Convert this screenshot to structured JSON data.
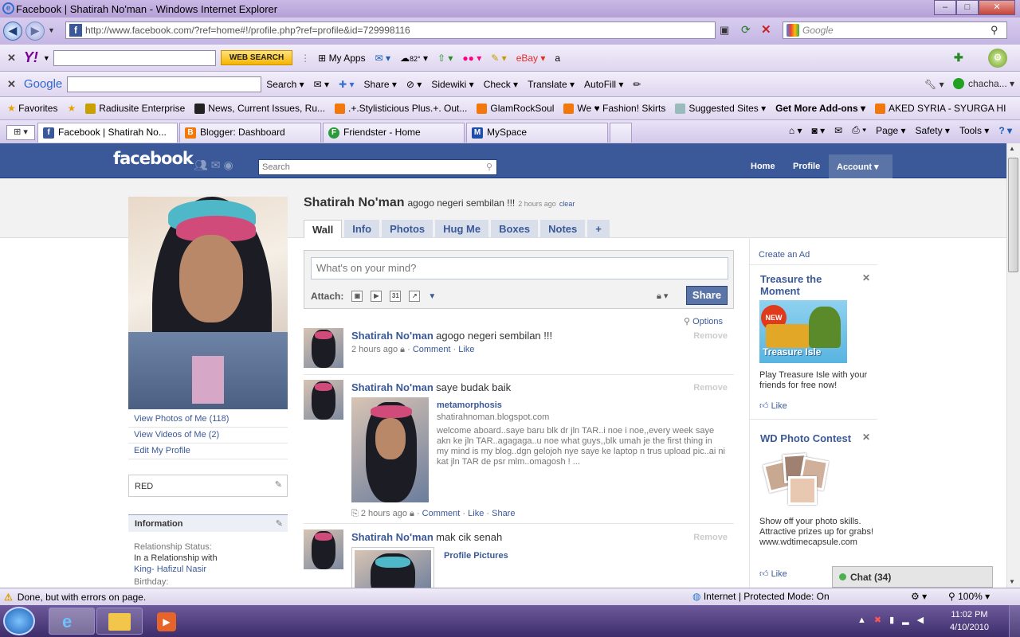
{
  "window": {
    "title": "Facebook | Shatirah No'man - Windows Internet Explorer",
    "btn_min": "–",
    "btn_max": "□",
    "btn_close": "✕"
  },
  "address": {
    "url": "http://www.facebook.com/?ref=home#!/profile.php?ref=profile&id=729998116",
    "search_placeholder": "Google"
  },
  "yahoo_bar": {
    "logo": "Y!",
    "search_btn": "WEB SEARCH",
    "my_apps": "My Apps",
    "weather": "82°"
  },
  "google_bar": {
    "logo": "Google",
    "items": [
      "Search ▾",
      "Share ▾",
      "Sidewiki ▾",
      "Check ▾",
      "Translate ▾",
      "AutoFill ▾"
    ],
    "user": "chacha... ▾"
  },
  "favorites_bar": {
    "favorites": "Favorites",
    "items": [
      "Radiusite Enterprise",
      "News, Current Issues, Ru...",
      ".+.Stylisticious Plus.+. Out...",
      "GlamRockSoul",
      "We ♥ Fashion! Skirts",
      "Suggested Sites ▾",
      "Get More Add-ons ▾",
      "AKED SYRIA - SYURGA HI"
    ]
  },
  "tabs": [
    {
      "label": "Facebook | Shatirah No...",
      "icon": "f"
    },
    {
      "label": "Blogger: Dashboard",
      "icon": "B"
    },
    {
      "label": "Friendster - Home",
      "icon": "F"
    },
    {
      "label": "MySpace",
      "icon": "M"
    }
  ],
  "cmdbar": {
    "page": "Page ▾",
    "safety": "Safety ▾",
    "tools": "Tools ▾",
    "help": "? ▾"
  },
  "fb": {
    "logo": "facebook",
    "search_placeholder": "Search",
    "nav": {
      "home": "Home",
      "profile": "Profile",
      "account": "Account ▾"
    },
    "profile": {
      "name": "Shatirah No'man",
      "status": "agogo negeri sembilan !!!",
      "status_time": "2 hours ago",
      "clear": "clear"
    },
    "profile_tabs": [
      "Wall",
      "Info",
      "Photos",
      "Hug Me",
      "Boxes",
      "Notes",
      "+"
    ],
    "left_links": [
      "View Photos of Me (118)",
      "View Videos of Me (2)",
      "Edit My Profile"
    ],
    "box_red": "RED",
    "info": {
      "header": "Information",
      "rel_label": "Relationship Status:",
      "rel_value": "In a Relationship with",
      "rel_name": "King- Hafizul Nasir",
      "birthday_label": "Birthday:"
    },
    "composer": {
      "placeholder": "What's on your mind?",
      "attach": "Attach:",
      "share": "Share"
    },
    "options": "Options",
    "posts": [
      {
        "name": "Shatirah No'man",
        "text": "agogo negeri sembilan !!!",
        "time": "2 hours ago",
        "comment": "Comment",
        "like": "Like",
        "remove": "Remove"
      },
      {
        "name": "Shatirah No'man",
        "text": "saye budak baik",
        "remove": "Remove",
        "link_title": "metamorphosis",
        "link_domain": "shatirahnoman.blogspot.com",
        "link_desc": "welcome aboard..saye baru blk dr jln TAR..i noe i noe,,every week saye akn ke jln TAR..agagaga..u noe what guys,,blk umah je the first thing in my mind is my blog..dgn gelojoh nye saye ke laptop n trus upload pic..ai ni kat jln TAR de psr mlm..omagosh ! ...",
        "time": "2 hours ago",
        "comment": "Comment",
        "like": "Like",
        "share": "Share"
      },
      {
        "name": "Shatirah No'man",
        "text": "mak cik senah",
        "remove": "Remove",
        "link_title": "Profile Pictures"
      }
    ],
    "ads": {
      "create": "Create an Ad",
      "ad1": {
        "title": "Treasure the Moment",
        "text": "Play Treasure Isle with your friends for free now!",
        "like": "Like",
        "badge": "NEW",
        "brand": "Treasure Isle"
      },
      "ad2": {
        "title": "WD Photo Contest",
        "text": "Show off your photo skills. Attractive prizes up for grabs!",
        "url": "www.wdtimecapsule.com",
        "like": "Like"
      }
    },
    "chat": "Chat (34)"
  },
  "status": {
    "text": "Done, but with errors on page.",
    "zone": "Internet | Protected Mode: On",
    "zoom": "100% ▾"
  },
  "clock": {
    "time": "11:02 PM",
    "date": "4/10/2010"
  }
}
